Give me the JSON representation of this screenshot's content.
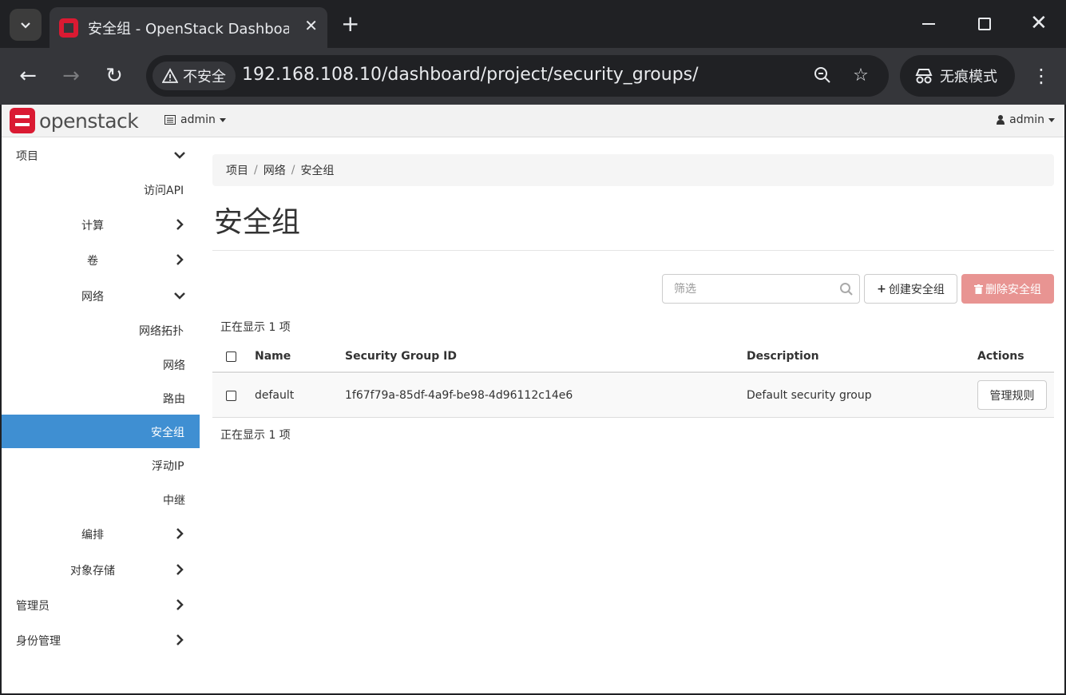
{
  "browser": {
    "tab_title": "安全组 - OpenStack Dashboard",
    "security_label": "不安全",
    "url": "192.168.108.10/dashboard/project/security_groups/",
    "incognito_label": "无痕模式"
  },
  "topbar": {
    "logo_text": "openstack",
    "project": "admin",
    "user": "admin"
  },
  "sidebar": {
    "items": [
      {
        "label": "项目",
        "icon": "chevron-down-icon"
      },
      {
        "label": "访问API"
      },
      {
        "label": "计算",
        "icon": "chevron-right-icon"
      },
      {
        "label": "卷",
        "icon": "chevron-right-icon"
      },
      {
        "label": "网络",
        "icon": "chevron-down-icon"
      },
      {
        "label": "网络拓扑"
      },
      {
        "label": "网络"
      },
      {
        "label": "路由"
      },
      {
        "label": "安全组",
        "active": true
      },
      {
        "label": "浮动IP"
      },
      {
        "label": "中继"
      },
      {
        "label": "编排",
        "icon": "chevron-right-icon"
      },
      {
        "label": "对象存储",
        "icon": "chevron-right-icon"
      },
      {
        "label": "管理员",
        "icon": "chevron-right-icon"
      },
      {
        "label": "身份管理",
        "icon": "chevron-right-icon"
      }
    ]
  },
  "breadcrumb": [
    "项目",
    "网络",
    "安全组"
  ],
  "page_title": "安全组",
  "filter": {
    "placeholder": "筛选"
  },
  "actions": {
    "create": "创建安全组",
    "delete": "删除安全组"
  },
  "count_top": "正在显示 1 项",
  "count_bottom": "正在显示 1 项",
  "table": {
    "columns": [
      "Name",
      "Security Group ID",
      "Description",
      "Actions"
    ],
    "rows": [
      {
        "name": "default",
        "id": "1f67f79a-85df-4a9f-be98-4d96112c14e6",
        "description": "Default security group",
        "action": "管理规则"
      }
    ]
  },
  "colors": {
    "accent": "#3f8fd2",
    "danger": "#e89492",
    "brand": "#da1a32"
  }
}
